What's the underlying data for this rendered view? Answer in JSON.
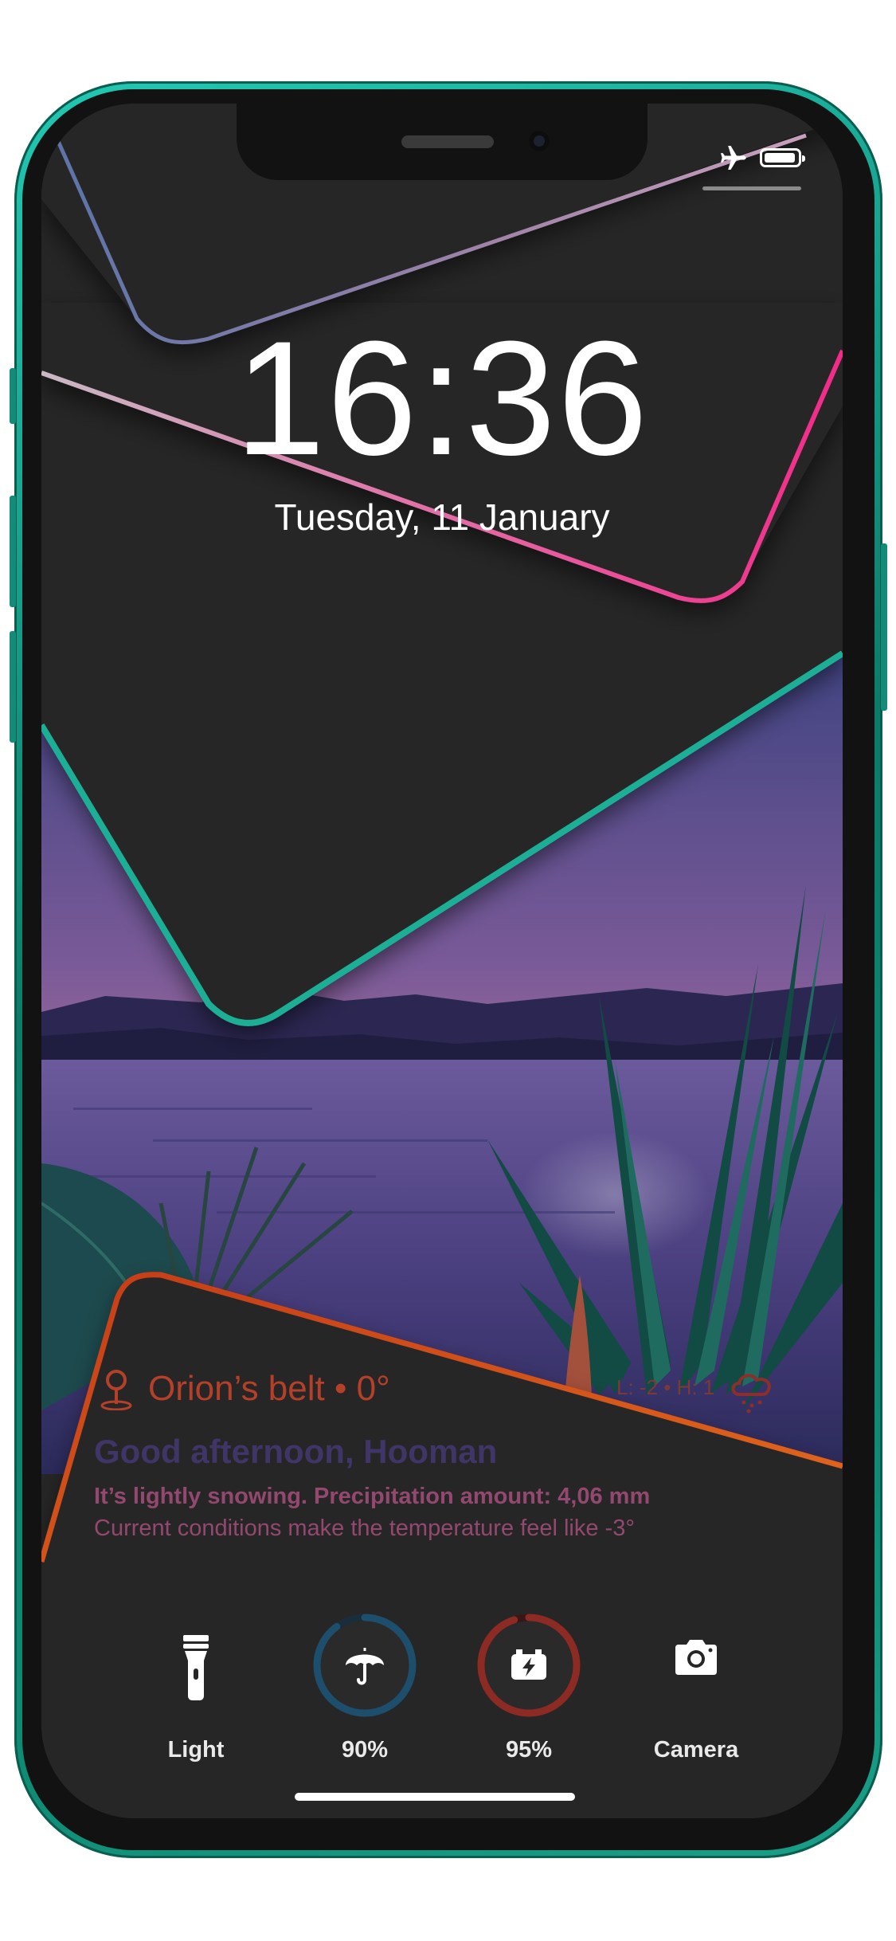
{
  "clock": {
    "time": "16:36",
    "date": "Tuesday, 11 January"
  },
  "status": {
    "airplane_icon": "airplane-icon",
    "battery_level": 0.95
  },
  "weather": {
    "location": "Orion’s belt • 0°",
    "low_high": "L: -2 • H: 1",
    "greeting": "Good afternoon, Hooman",
    "precipitation": "It’s lightly snowing. Precipitation amount: 4,06 mm",
    "feels_like": "Current conditions make the temperature feel like -3°",
    "icons": {
      "location": "location-pin-icon",
      "condition": "snow-cloud-icon"
    }
  },
  "dock": {
    "light_label": "Light",
    "rain_label": "90%",
    "rain_level": 0.9,
    "battery_label": "95%",
    "battery_level": 0.95,
    "camera_label": "Camera"
  },
  "colors": {
    "frame": "#0f8a73",
    "pink_accent": "#f02a88",
    "teal_accent": "#1dae96",
    "orange_accent": "#d9471c",
    "rain_ring": "#1d4e6b",
    "battery_ring": "#8c2a24"
  }
}
